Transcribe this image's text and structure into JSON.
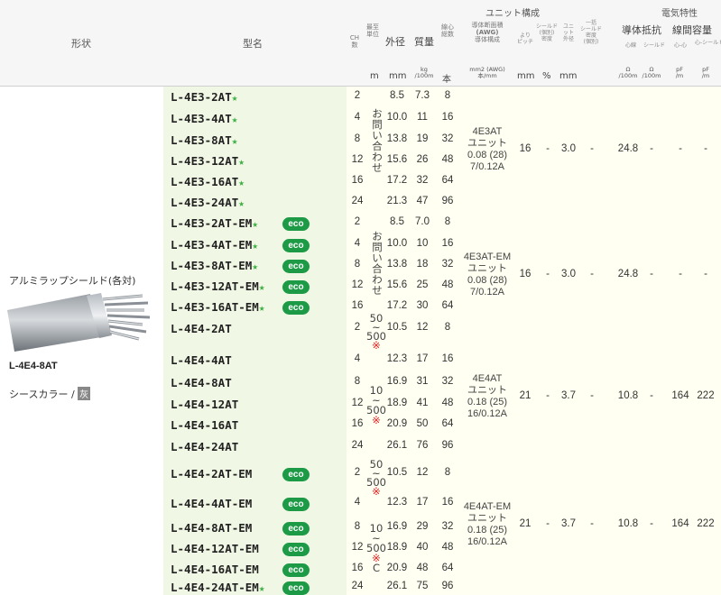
{
  "header": {
    "shape": "形状",
    "model": "型名",
    "ch": [
      "CH",
      "数"
    ],
    "unit_pack": [
      "最至",
      "単位"
    ],
    "outer_dia": "外径",
    "mass": "質量",
    "wire_count": [
      "線心",
      "総数"
    ],
    "unit_config": "ユニット構成",
    "conductor": [
      "導体断面積",
      "(AWG)",
      "導体構成"
    ],
    "twist": [
      "より",
      "ピッチ"
    ],
    "shield_density": [
      "シールド",
      "(個別)",
      "密度"
    ],
    "unit_od": [
      "ユニ",
      "ット",
      "外径"
    ],
    "overall_shield": [
      "一括",
      "シールド",
      "密度",
      "(個別)"
    ],
    "electrical": "電気特性",
    "cond_res": "導体抵抗",
    "capacitance": "線間容量",
    "res_sub": [
      "心線",
      "シールド"
    ],
    "cap_sub": [
      "心-心",
      "心-シールド"
    ],
    "units": {
      "m": "m",
      "mm": "mm",
      "kg": "kg",
      "per100": "/100m",
      "wires": "本",
      "cond": "mm2 (AWG)",
      "cond2": "本/mm",
      "twist": "mm",
      "pct": "%",
      "od": "mm",
      "ohm1": "Ω",
      "ohm1b": "/100m",
      "ohm2": "Ω",
      "ohm2b": "/100m",
      "pf1": "pF",
      "pf1b": "/m",
      "pf2": "pF",
      "pf2b": "/m"
    }
  },
  "side": {
    "type_name": "アルミラップシールド(各対)",
    "photo_model": "L-4E4-8AT",
    "sheath_label": "シースカラー /",
    "sheath_color": "灰"
  },
  "rows": [
    {
      "model": "L-4E3-2AT",
      "star": "★",
      "eco": "",
      "ch": "2",
      "od": "8.5",
      "mass": "7.3",
      "wires": "8"
    },
    {
      "model": "L-4E3-4AT",
      "star": "★",
      "eco": "",
      "ch": "4",
      "od": "10.0",
      "mass": "11",
      "wires": "16"
    },
    {
      "model": "L-4E3-8AT",
      "star": "★",
      "eco": "",
      "ch": "8",
      "od": "13.8",
      "mass": "19",
      "wires": "32"
    },
    {
      "model": "L-4E3-12AT",
      "star": "★",
      "eco": "",
      "ch": "12",
      "od": "15.6",
      "mass": "26",
      "wires": "48"
    },
    {
      "model": "L-4E3-16AT",
      "star": "★",
      "eco": "",
      "ch": "16",
      "od": "17.2",
      "mass": "32",
      "wires": "64"
    },
    {
      "model": "L-4E3-24AT",
      "star": "★",
      "eco": "",
      "ch": "24",
      "od": "21.3",
      "mass": "47",
      "wires": "96"
    },
    {
      "model": "L-4E3-2AT-EM",
      "star": "★",
      "eco": "eco",
      "ch": "2",
      "od": "8.5",
      "mass": "7.0",
      "wires": "8"
    },
    {
      "model": "L-4E3-4AT-EM",
      "star": "★",
      "eco": "eco",
      "ch": "4",
      "od": "10.0",
      "mass": "10",
      "wires": "16"
    },
    {
      "model": "L-4E3-8AT-EM",
      "star": "★",
      "eco": "eco",
      "ch": "8",
      "od": "13.8",
      "mass": "18",
      "wires": "32"
    },
    {
      "model": "L-4E3-12AT-EM",
      "star": "★",
      "eco": "eco",
      "ch": "12",
      "od": "15.6",
      "mass": "25",
      "wires": "48"
    },
    {
      "model": "L-4E3-16AT-EM",
      "star": "★",
      "eco": "eco",
      "ch": "16",
      "od": "17.2",
      "mass": "30",
      "wires": "64"
    },
    {
      "model": "L-4E4-2AT",
      "star": "",
      "eco": "",
      "ch": "2",
      "od": "10.5",
      "mass": "12",
      "wires": "8"
    },
    {
      "model": "L-4E4-4AT",
      "star": "",
      "eco": "",
      "ch": "4",
      "od": "12.3",
      "mass": "17",
      "wires": "16"
    },
    {
      "model": "L-4E4-8AT",
      "star": "",
      "eco": "",
      "ch": "8",
      "od": "16.9",
      "mass": "31",
      "wires": "32"
    },
    {
      "model": "L-4E4-12AT",
      "star": "",
      "eco": "",
      "ch": "12",
      "od": "18.9",
      "mass": "41",
      "wires": "48"
    },
    {
      "model": "L-4E4-16AT",
      "star": "",
      "eco": "",
      "ch": "16",
      "od": "20.9",
      "mass": "50",
      "wires": "64"
    },
    {
      "model": "L-4E4-24AT",
      "star": "",
      "eco": "",
      "ch": "24",
      "od": "26.1",
      "mass": "76",
      "wires": "96"
    },
    {
      "model": "L-4E4-2AT-EM",
      "star": "",
      "eco": "eco",
      "ch": "2",
      "od": "10.5",
      "mass": "12",
      "wires": "8"
    },
    {
      "model": "L-4E4-4AT-EM",
      "star": "",
      "eco": "eco",
      "ch": "4",
      "od": "12.3",
      "mass": "17",
      "wires": "16"
    },
    {
      "model": "L-4E4-8AT-EM",
      "star": "",
      "eco": "eco",
      "ch": "8",
      "od": "16.9",
      "mass": "29",
      "wires": "32"
    },
    {
      "model": "L-4E4-12AT-EM",
      "star": "",
      "eco": "eco",
      "ch": "12",
      "od": "18.9",
      "mass": "40",
      "wires": "48"
    },
    {
      "model": "L-4E4-16AT-EM",
      "star": "",
      "eco": "eco",
      "ch": "16",
      "od": "20.9",
      "mass": "48",
      "wires": "64"
    },
    {
      "model": "L-4E4-24AT-EM",
      "star": "★",
      "eco": "eco",
      "ch": "24",
      "od": "26.1",
      "mass": "75",
      "wires": "96"
    }
  ],
  "unit_notes": {
    "ask": [
      "お",
      "問",
      "い",
      "合",
      "わ",
      "せ"
    ],
    "g3_500": [
      "50",
      "~",
      "500",
      "※"
    ],
    "g3_10": [
      "10",
      "~",
      "500",
      "※"
    ],
    "g4_500": [
      "50",
      "~",
      "500",
      "※"
    ],
    "g4_10": [
      "10",
      "~",
      "500",
      "※",
      "C"
    ]
  },
  "groups": [
    {
      "unit": [
        "4E3AT",
        "ユニット",
        "0.08 (28)",
        "7/0.12A"
      ],
      "twist": "16",
      "shield": "-",
      "unit_od": "3.0",
      "overall": "-",
      "res1": "24.8",
      "res2": "-",
      "cap1": "-",
      "cap2": "-"
    },
    {
      "unit": [
        "4E3AT-EM",
        "ユニット",
        "0.08 (28)",
        "7/0.12A"
      ],
      "twist": "16",
      "shield": "-",
      "unit_od": "3.0",
      "overall": "-",
      "res1": "24.8",
      "res2": "-",
      "cap1": "-",
      "cap2": "-"
    },
    {
      "unit": [
        "4E4AT",
        "ユニット",
        "0.18 (25)",
        "16/0.12A"
      ],
      "twist": "21",
      "shield": "-",
      "unit_od": "3.7",
      "overall": "-",
      "res1": "10.8",
      "res2": "-",
      "cap1": "164",
      "cap2": "222"
    },
    {
      "unit": [
        "4E4AT-EM",
        "ユニット",
        "0.18 (25)",
        "16/0.12A"
      ],
      "twist": "21",
      "shield": "-",
      "unit_od": "3.7",
      "overall": "-",
      "res1": "10.8",
      "res2": "-",
      "cap1": "164",
      "cap2": "222"
    }
  ],
  "colors": {
    "accent_green": "#1d9a46",
    "star": "#3cb043",
    "note_red": "#e02020",
    "row_green": "#f0f7e4",
    "row_yellow": "#fffff2"
  },
  "icons": [
    "eco-badge-icon",
    "star-icon",
    "cable-photo"
  ]
}
